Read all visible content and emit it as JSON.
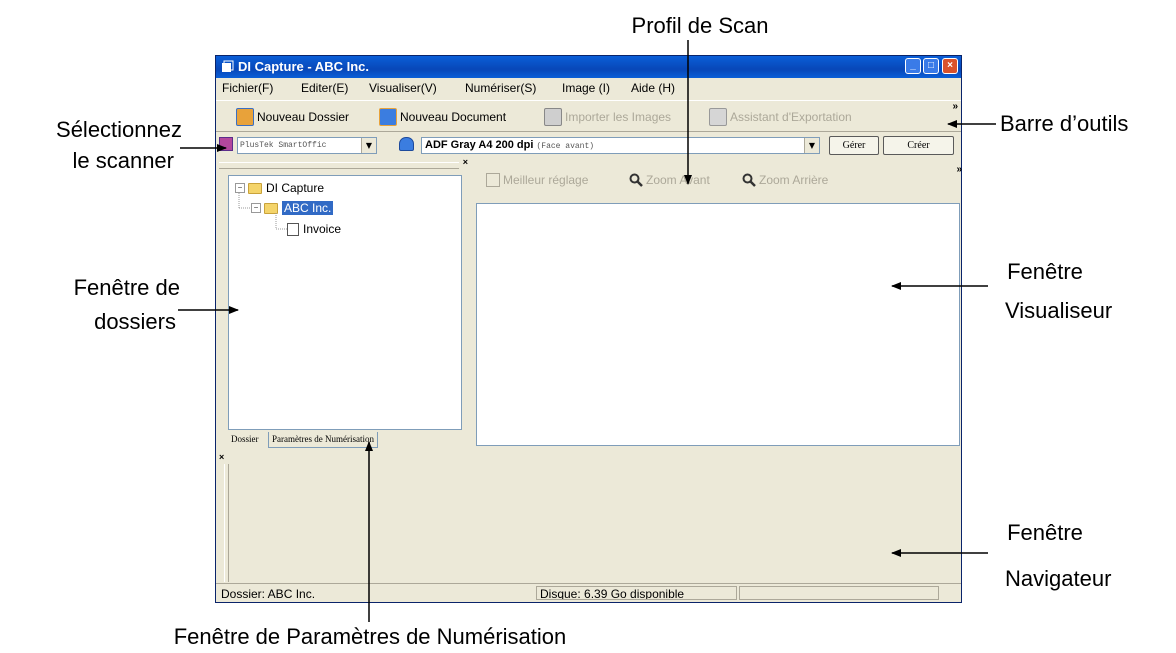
{
  "callouts": {
    "profile": "Profil de Scan",
    "toolbar": "Barre d’outils",
    "scanner_line1": "Sélectionnez",
    "scanner_line2": "le scanner",
    "folder_line1": "Fenêtre de",
    "folder_line2": "dossiers",
    "viewer_line1": "Fenêtre",
    "viewer_line2": "Visualiseur",
    "navigator_line1": "Fenêtre",
    "navigator_line2": "Navigateur",
    "scan_params": "Fenêtre de Paramètres de Numérisation"
  },
  "window": {
    "title": "DI Capture - ABC Inc.",
    "min_icon": "minimize-icon",
    "max_icon": "maximize-icon",
    "close_icon": "close-icon"
  },
  "menu": [
    "Fichier(F)",
    "Editer(E)",
    "Visualiser(V)",
    "Numériser(S)",
    "Image (I)",
    "Aide (H)"
  ],
  "toolbar": {
    "new_folder": "Nouveau Dossier",
    "new_document": "Nouveau Document",
    "import_images": "Importer les Images",
    "export_assistant": "Assistant d'Exportation",
    "more": "»"
  },
  "scan_bar": {
    "scanner": "PlusTek SmartOffic",
    "profile_main": "ADF Gray A4 200 dpi",
    "profile_sub": "(Face avant)",
    "manage": "Gérer",
    "create": "Créer"
  },
  "tree": {
    "root": "DI Capture",
    "child": "ABC Inc.",
    "leaf": "Invoice",
    "expand_symbol": "−"
  },
  "tabs": {
    "folder": "Dossier",
    "scan_params": "Paramètres de Numérisation"
  },
  "viewer_toolbar": {
    "best_fit": "Meilleur réglage",
    "zoom_in": "Zoom Avant",
    "zoom_out": "Zoom Arrière"
  },
  "pane_close": "×",
  "status": {
    "folder": "Dossier: ABC Inc.",
    "disk": "Disque: 6.39 Go disponible"
  },
  "colors": {
    "title_bar": "#0a5fd8",
    "selection": "#316ac5",
    "window_bg": "#ece9d8"
  }
}
